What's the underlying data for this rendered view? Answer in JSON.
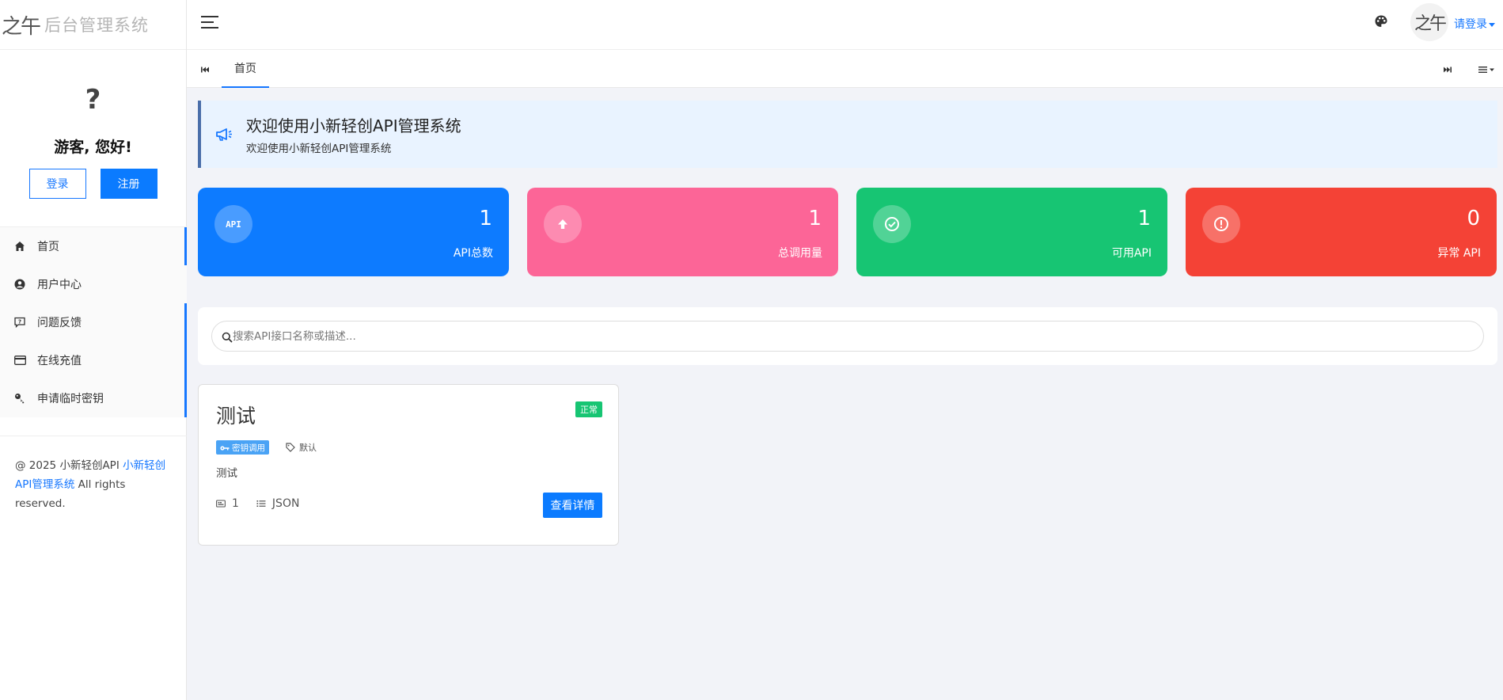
{
  "brand": {
    "logo_text": "之午",
    "title": "后台管理系统"
  },
  "guest": {
    "avatar_glyph": "?",
    "greeting": "游客, 您好!",
    "login_label": "登录",
    "register_label": "注册"
  },
  "nav": {
    "items": [
      {
        "label": "首页",
        "icon": "home-icon"
      },
      {
        "label": "用户中心",
        "icon": "user-circle-icon"
      },
      {
        "label": "问题反馈",
        "icon": "feedback-icon"
      },
      {
        "label": "在线充值",
        "icon": "credit-card-icon"
      },
      {
        "label": "申请临时密钥",
        "icon": "key-icon"
      }
    ]
  },
  "footer": {
    "prefix": "@ 2025 小新轻创API ",
    "link": "小新轻创API管理系统",
    "suffix": " All rights reserved."
  },
  "header": {
    "avatar_text": "之午",
    "login_label": "请登录"
  },
  "tabs": {
    "home_label": "首页"
  },
  "notice": {
    "title": "欢迎使用小新轻创API管理系统",
    "subtitle": "欢迎使用小新轻创API管理系统"
  },
  "stats": [
    {
      "value": "1",
      "label": "API总数",
      "icon_text": "API",
      "color": "#0d7bff"
    },
    {
      "value": "1",
      "label": "总调用量",
      "icon": "arrow-up-icon",
      "color": "#fc6597"
    },
    {
      "value": "1",
      "label": "可用API",
      "icon": "check-circle-icon",
      "color": "#17c573"
    },
    {
      "value": "0",
      "label": "异常 API",
      "icon": "alert-circle-icon",
      "color": "#f44236"
    }
  ],
  "search": {
    "placeholder": "搜索API接口名称或描述..."
  },
  "api_card": {
    "title": "测试",
    "status": "正常",
    "tag": "密钥调用",
    "category": "默认",
    "description": "测试",
    "count": "1",
    "format": "JSON",
    "detail_label": "查看详情"
  }
}
